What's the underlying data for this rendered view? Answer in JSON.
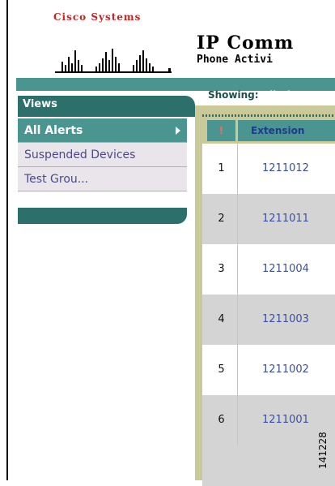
{
  "header": {
    "logo_text": "Cisco Systems",
    "title": "IP Comm",
    "subtitle": "Phone Activi"
  },
  "showing": {
    "label": "Showing:",
    "value": "All Ale"
  },
  "views": {
    "title": "Views",
    "items": [
      {
        "label": "All Alerts",
        "active": true
      },
      {
        "label": "Suspended Devices",
        "active": false
      },
      {
        "label": "Test Grou...",
        "active": false
      }
    ]
  },
  "table": {
    "columns": [
      "!",
      "Extension"
    ],
    "rows": [
      {
        "num": "1",
        "extension": "1211012"
      },
      {
        "num": "2",
        "extension": "1211011"
      },
      {
        "num": "3",
        "extension": "1211004"
      },
      {
        "num": "4",
        "extension": "1211003"
      },
      {
        "num": "5",
        "extension": "1211002"
      },
      {
        "num": "6",
        "extension": "1211001"
      }
    ]
  },
  "figure_id": "141228",
  "colors": {
    "teal_dark": "#2d6f6a",
    "teal": "#4a9590",
    "olive": "#c9c99a",
    "logo_red": "#cc2222",
    "link_blue": "#3a4fa0"
  }
}
